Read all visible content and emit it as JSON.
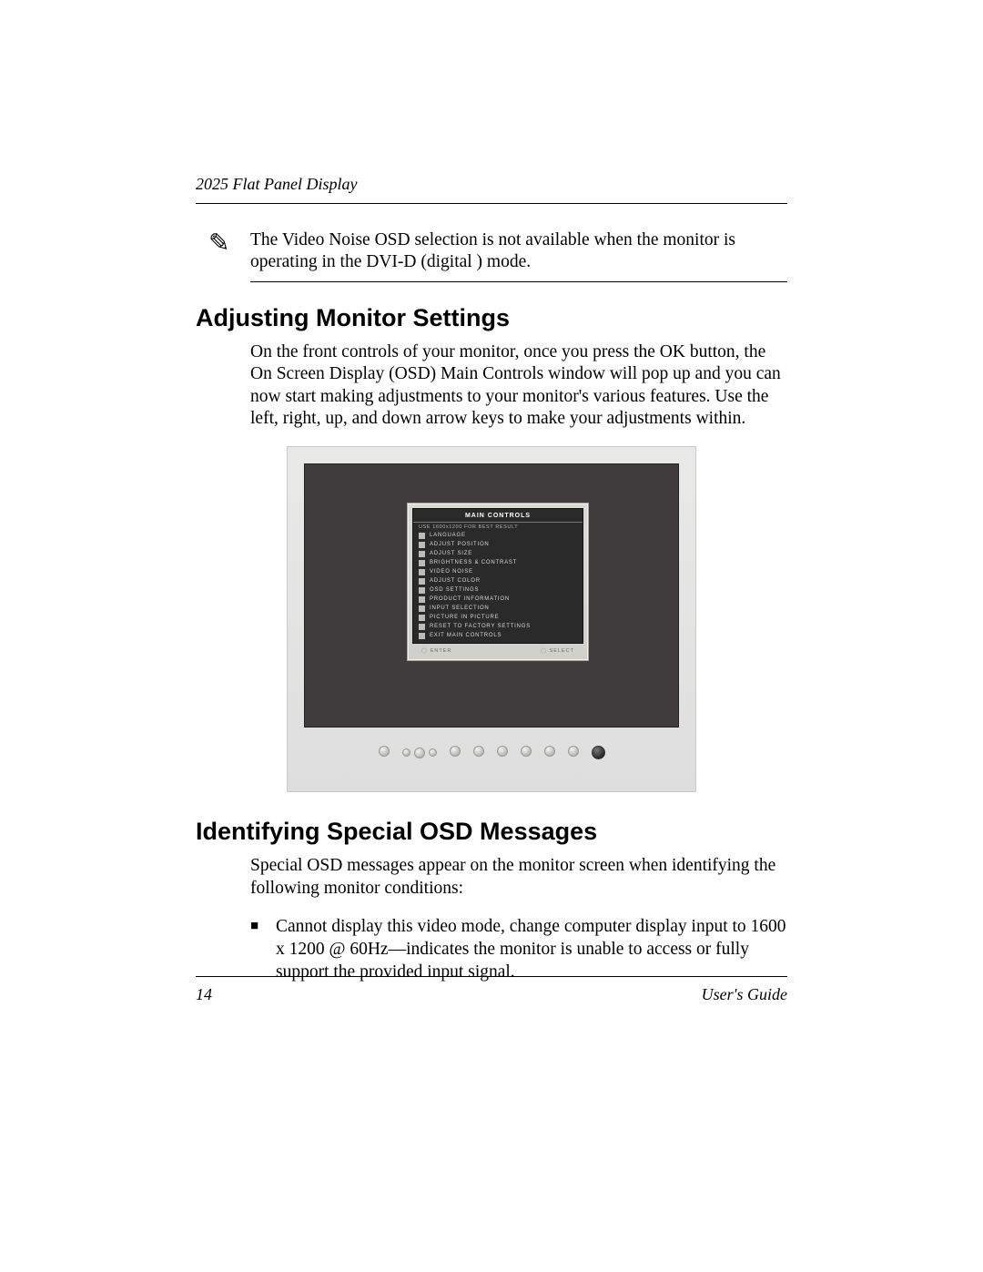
{
  "header": {
    "running_head": "2025 Flat Panel Display"
  },
  "note": {
    "text": "The Video Noise OSD selection is not available when the monitor is operating in the DVI-D (digital ) mode."
  },
  "section1": {
    "heading": "Adjusting Monitor Settings",
    "body": "On the front controls of your monitor, once you press the OK button, the On Screen Display (OSD) Main Controls window will pop up and you can now start making adjustments to your monitor's various features. Use the left, right, up, and down arrow keys to make your adjustments within."
  },
  "osd": {
    "title": "MAIN CONTROLS",
    "subtitle": "USE 1600x1200 FOR BEST RESULT",
    "items": [
      "LANGUAGE",
      "ADJUST POSITION",
      "ADJUST SIZE",
      "BRIGHTNESS & CONTRAST",
      "VIDEO NOISE",
      "ADJUST COLOR",
      "OSD SETTINGS",
      "PRODUCT INFORMATION",
      "INPUT SELECTION",
      "PICTURE IN PICTURE",
      "RESET TO FACTORY SETTINGS",
      "EXIT MAIN CONTROLS"
    ],
    "btn_enter": "ENTER",
    "btn_select": "SELECT"
  },
  "section2": {
    "heading": "Identifying Special OSD Messages",
    "body": "Special OSD messages appear on the monitor screen when identifying the following monitor conditions:",
    "bullet": "Cannot display this video mode, change computer display input to 1600 x 1200 @ 60Hz—indicates the monitor is unable to access or fully support the provided input signal."
  },
  "footer": {
    "page_number": "14",
    "guide_label": "User's Guide"
  }
}
